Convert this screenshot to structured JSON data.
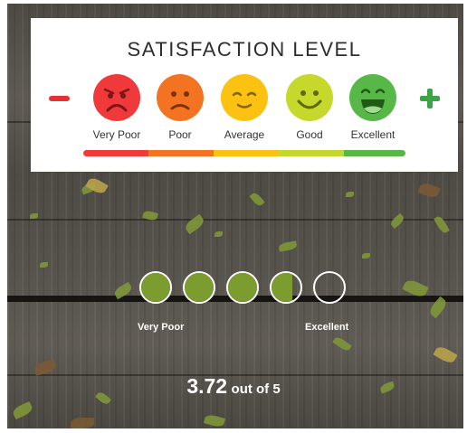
{
  "card": {
    "title": "SATISFACTION LEVEL",
    "minus_icon": "minus-icon",
    "plus_icon": "plus-icon",
    "faces": [
      {
        "label": "Very Poor",
        "icon": "very-poor-face-icon",
        "color": "#f0393a"
      },
      {
        "label": "Poor",
        "icon": "poor-face-icon",
        "color": "#f37320"
      },
      {
        "label": "Average",
        "icon": "average-face-icon",
        "color": "#fcc211"
      },
      {
        "label": "Good",
        "icon": "good-face-icon",
        "color": "#c6d82b"
      },
      {
        "label": "Excellent",
        "icon": "excellent-face-icon",
        "color": "#57b847"
      }
    ]
  },
  "rating": {
    "value": 3.72,
    "max": 5,
    "fill_color": "#7d9c2f",
    "min_label": "Very Poor",
    "max_label": "Excellent",
    "score_value": "3.72",
    "score_suffix": "out of 5"
  }
}
